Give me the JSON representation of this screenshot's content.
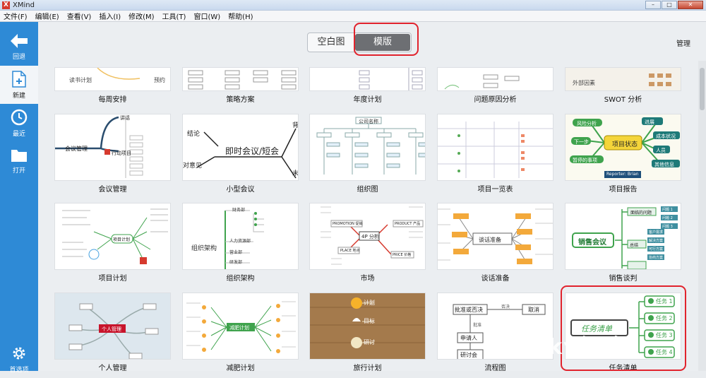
{
  "window": {
    "app_name": "XMind",
    "logo_letter": "X",
    "controls": [
      "–",
      "□",
      "✕"
    ]
  },
  "menu": [
    "文件(F)",
    "编辑(E)",
    "查看(V)",
    "插入(I)",
    "修改(M)",
    "工具(T)",
    "窗口(W)",
    "帮助(H)"
  ],
  "sidebar": {
    "items": [
      {
        "label": "回退",
        "icon": "back-arrow-icon"
      },
      {
        "label": "新建",
        "icon": "new-file-icon"
      },
      {
        "label": "最近",
        "icon": "clock-icon"
      },
      {
        "label": "打开",
        "icon": "folder-icon"
      },
      {
        "label": "首选项",
        "icon": "gear-icon"
      }
    ],
    "active_index": 1
  },
  "tabs": {
    "blank": "空白图",
    "template": "模版",
    "selected": "模版"
  },
  "manage_label": "管理",
  "templates": [
    {
      "label": "每周安排"
    },
    {
      "label": "策略方案"
    },
    {
      "label": "年度计划"
    },
    {
      "label": "问题原因分析"
    },
    {
      "label": "SWOT 分析"
    },
    {
      "label": "会议管理"
    },
    {
      "label": "小型会议"
    },
    {
      "label": "组织图"
    },
    {
      "label": "项目一览表"
    },
    {
      "label": "项目报告"
    },
    {
      "label": "项目计划"
    },
    {
      "label": "组织架构"
    },
    {
      "label": "市场"
    },
    {
      "label": "谈话准备"
    },
    {
      "label": "销售谈判"
    },
    {
      "label": "个人管理"
    },
    {
      "label": "减肥计划"
    },
    {
      "label": "旅行计划"
    },
    {
      "label": "流程图"
    },
    {
      "label": "任务清单"
    }
  ],
  "thumb_text": {
    "weekly": [
      "读书计划",
      "预约"
    ],
    "swot": [
      "外部因素"
    ],
    "meeting": [
      "会议管理",
      "讲话",
      "行动项目"
    ],
    "small_meeting": [
      "即时会议/短会",
      "结论",
      "对意见",
      "背",
      "未"
    ],
    "org_chart": [
      "公司名称"
    ],
    "project_report": [
      "项目状态",
      "风险分析",
      "下一步",
      "暂停的事项",
      "进展",
      "成本状况",
      "人员",
      "其他信息",
      "Reporter: Brian"
    ],
    "project_plan": [
      "项目计划"
    ],
    "org_structure": [
      "组织架构",
      "人力资源部",
      "营业部",
      "研发部",
      "财务部"
    ],
    "market": [
      "4P 分析",
      "PROMOTION 促销",
      "PRODUCT 产品",
      "PLACE 地点",
      "PRICE 价格"
    ],
    "talk_prep": [
      "谈话准备"
    ],
    "sales": [
      "销售会议",
      "面临的问题",
      "问题 1",
      "问题 2",
      "问题 3",
      "客户需求",
      "解决方案",
      "可行方案",
      "协商方案",
      "总结"
    ],
    "personal": [
      "个人管理"
    ],
    "diet": [
      "减肥计划"
    ],
    "travel": [
      "计划",
      "目标",
      "研讨"
    ],
    "flow": [
      "批准或否决",
      "否决",
      "取消",
      "批准",
      "申请人",
      "研讨会"
    ],
    "tasks": [
      "任务清单",
      "任务 1",
      "任务 2",
      "任务 3",
      "任务 4"
    ]
  },
  "watermark": "aky经验",
  "colors": {
    "sidebar": "#2e8ad6",
    "highlight": "#e1232d",
    "green_node": "#3fa34d",
    "teal_node": "#1e7a78"
  }
}
